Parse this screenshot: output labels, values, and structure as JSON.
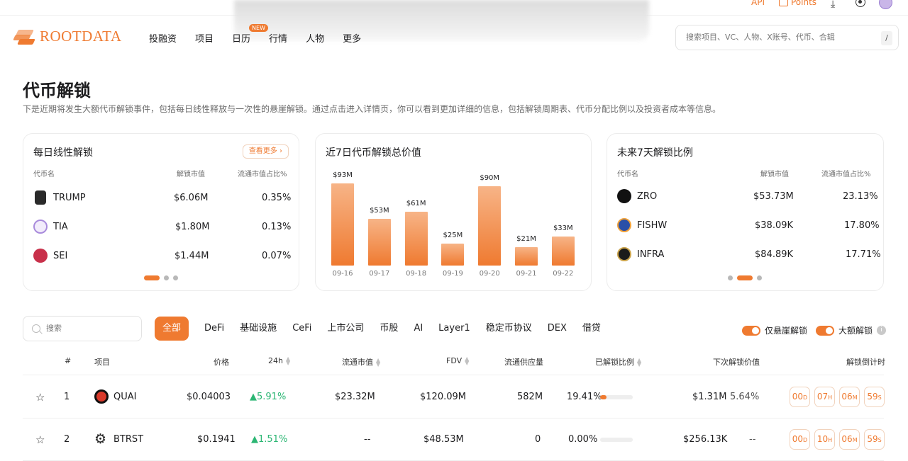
{
  "topbar": {
    "api": "API",
    "points": "Points"
  },
  "logo": {
    "text": "ROOTDATA"
  },
  "nav": {
    "items": [
      "投融资",
      "项目",
      "日历",
      "行情",
      "人物",
      "更多"
    ],
    "new_badge": "NEW"
  },
  "search": {
    "placeholder": "搜索项目、VC、人物、X账号、代币、合辑",
    "shortcut": "/"
  },
  "page": {
    "title": "代币解锁",
    "description": "下是近期将发生大额代币解锁事件，包括每日线性释放与一次性的悬崖解锁。通过点击进入详情页，你可以看到更加详细的信息，包括解锁周期表、代币分配比例以及投资者成本等信息。"
  },
  "daily_card": {
    "title": "每日线性解锁",
    "more": "查看更多 ›",
    "headers": [
      "代币名",
      "解锁市值",
      "流通市值占比%"
    ],
    "rows": [
      {
        "name": "TRUMP",
        "value": "$6.06M",
        "pct": "0.35%"
      },
      {
        "name": "TIA",
        "value": "$1.80M",
        "pct": "0.13%"
      },
      {
        "name": "SEI",
        "value": "$1.44M",
        "pct": "0.07%"
      }
    ]
  },
  "chart_card": {
    "title": "近7日代币解锁总价值"
  },
  "chart_data": {
    "type": "bar",
    "title": "近7日代币解锁总价值",
    "categories": [
      "09-16",
      "09-17",
      "09-18",
      "09-19",
      "09-20",
      "09-21",
      "09-22"
    ],
    "values": [
      93,
      53,
      61,
      25,
      90,
      21,
      33
    ],
    "labels": [
      "$93M",
      "$53M",
      "$61M",
      "$25M",
      "$90M",
      "$21M",
      "$33M"
    ],
    "ylim": [
      0,
      100
    ],
    "grid": false
  },
  "ratio_card": {
    "title": "未来7天解锁比例",
    "headers": [
      "代币名",
      "解锁市值",
      "流通市值占比%"
    ],
    "rows": [
      {
        "name": "ZRO",
        "value": "$53.73M",
        "pct": "23.13%"
      },
      {
        "name": "FISHW",
        "value": "$38.09K",
        "pct": "17.80%"
      },
      {
        "name": "INFRA",
        "value": "$84.89K",
        "pct": "17.71%"
      }
    ]
  },
  "filters": {
    "search_placeholder": "搜索",
    "tabs": [
      "全部",
      "DeFi",
      "基础设施",
      "CeFi",
      "上市公司",
      "币股",
      "AI",
      "Layer1",
      "稳定币协议",
      "DEX",
      "借贷"
    ],
    "toggle_cliff": "仅悬崖解锁",
    "toggle_large": "大额解锁",
    "info_icon": "info-icon"
  },
  "table": {
    "headers": [
      "#",
      "项目",
      "价格",
      "24h",
      "流通市值",
      "FDV",
      "流通供应量",
      "已解锁比例",
      "下次解锁价值",
      "解锁倒计时"
    ],
    "rows": [
      {
        "rank": "1",
        "name": "QUAI",
        "price": "$0.04003",
        "change": "▲5.91%",
        "mcap": "$23.32M",
        "fdv": "$120.09M",
        "supply": "582M",
        "unlocked": "19.41%",
        "unlocked_frac": 0.1941,
        "next_value": "$1.31M",
        "next_pct": "5.64%",
        "cd": [
          "00",
          "07",
          "06",
          "59"
        ]
      },
      {
        "rank": "2",
        "name": "BTRST",
        "price": "$0.1941",
        "change": "▲1.51%",
        "mcap": "--",
        "fdv": "$48.53M",
        "supply": "0",
        "unlocked": "0.00%",
        "unlocked_frac": 0.0,
        "next_value": "$256.13K",
        "next_pct": "--",
        "cd": [
          "00",
          "10",
          "06",
          "59"
        ]
      }
    ],
    "cd_units": [
      "D",
      "H",
      "M",
      "S"
    ]
  }
}
